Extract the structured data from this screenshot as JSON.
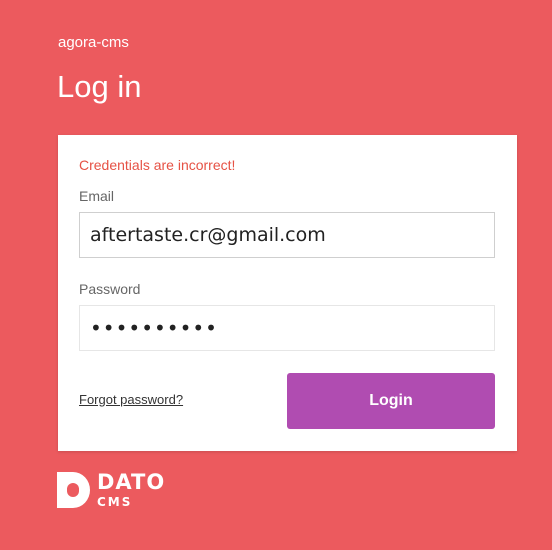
{
  "header": {
    "project_name": "agora-cms",
    "title": "Log in"
  },
  "form": {
    "error_message": "Credentials are incorrect!",
    "email_label": "Email",
    "email_value": "aftertaste.cr@gmail.com",
    "password_label": "Password",
    "password_value": "••••••••••",
    "forgot_password": "Forgot password?",
    "login_button": "Login"
  },
  "brand": {
    "main": "DATO",
    "sub": "CMS",
    "icon": "dato-logo-icon"
  },
  "colors": {
    "background": "#ec5a5e",
    "button": "#b04cb1",
    "error": "#e65245"
  }
}
